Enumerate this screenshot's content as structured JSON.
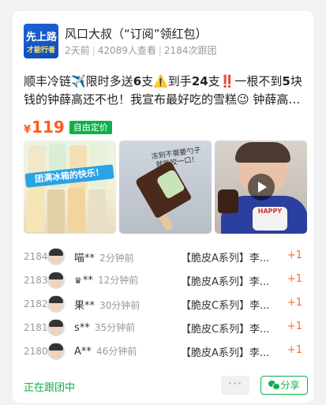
{
  "header": {
    "avatar_line1": "先上路",
    "avatar_line2": "才能行者",
    "title": "风口大叔（“订阅”领红包）",
    "time_ago": "2天前",
    "views": "42089人查看",
    "followers": "2184次跟团"
  },
  "post": {
    "desc_part1": "顺丰冷链✈️限时多送",
    "desc_bold1": "6",
    "desc_part2": "支⚠️到手",
    "desc_bold2": "24",
    "desc_part3": "支‼️一根不到",
    "desc_bold3": "5",
    "desc_part4": "块钱的钟薛高还不也！我宣布最好吃的雪糕😉 钟薛高…",
    "currency": "¥",
    "price": "119",
    "price_tag": "自由定价"
  },
  "gallery": {
    "banner_text": "团满冰箱的快乐！",
    "note_text": "冻到不需要勺子就能咬一口！",
    "kid_shirt_text": "HAPPY"
  },
  "orders": [
    {
      "no": "2184",
      "name": "喵**",
      "time": "2分钟前",
      "item": "【脆皮A系列】李...",
      "qty": "+1",
      "crown": ""
    },
    {
      "no": "2183",
      "name": "**",
      "time": "12分钟前",
      "item": "【脆皮A系列】李...",
      "qty": "+1",
      "crown": "♛"
    },
    {
      "no": "2182",
      "name": "果**",
      "time": "30分钟前",
      "item": "【脆皮C系列】李...",
      "qty": "+1",
      "crown": ""
    },
    {
      "no": "2181",
      "name": "s**",
      "time": "35分钟前",
      "item": "【脆皮C系列】李...",
      "qty": "+1",
      "crown": ""
    },
    {
      "no": "2180",
      "name": "A**",
      "time": "46分钟前",
      "item": "【脆皮A系列】李...",
      "qty": "+1",
      "crown": ""
    }
  ],
  "footer": {
    "following_label": "正在跟团中",
    "more_label": "···",
    "share_label": "分享"
  },
  "colors": {
    "accent_green": "#10b04a",
    "price_orange": "#ff5a1f"
  }
}
